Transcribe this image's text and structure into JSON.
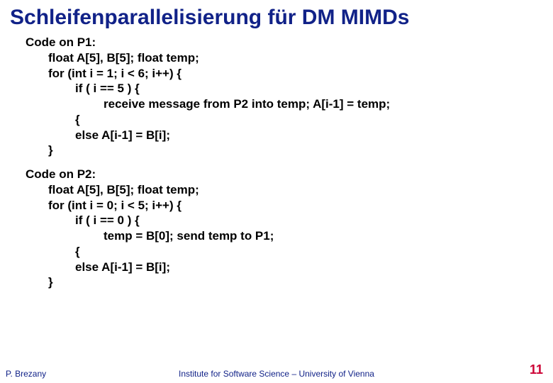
{
  "title": "Schleifenparallelisierung für DM MIMDs",
  "p1": {
    "h": "Code on P1:",
    "l1": "float A[5], B[5]; float temp;",
    "l2": "for (int i = 1; i < 6; i++) {",
    "l3": "if ( i == 5 ) {",
    "l4": "receive message from P2 into temp;  A[i-1] = temp;",
    "l5": "{",
    "l6": "else A[i-1] = B[i];",
    "l7": "}"
  },
  "p2": {
    "h": "Code on P2:",
    "l1": "float A[5], B[5]; float temp;",
    "l2": "for (int i = 0; i < 5; i++) {",
    "l3": "if ( i == 0 ) {",
    "l4": "temp = B[0];  send temp to P1;",
    "l5": "{",
    "l6": "else  A[i-1] = B[i];",
    "l7": "}"
  },
  "footer": {
    "author": "P. Brezany",
    "institute": "Institute for Software Science – University of Vienna",
    "page": "11"
  }
}
